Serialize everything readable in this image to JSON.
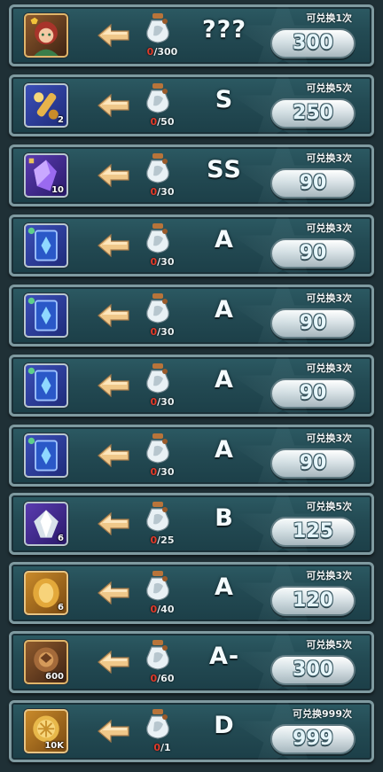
{
  "exchange_rows": [
    {
      "item_icon": "hero-portrait-icon",
      "item_style": "hero",
      "item_qty": "",
      "have": "0",
      "need": "/300",
      "grade": "???",
      "limit": "可兑换1次",
      "price": "300"
    },
    {
      "item_icon": "golden-scroll-icon",
      "item_style": "blue",
      "item_qty": "2",
      "have": "0",
      "need": "/50",
      "grade": "S",
      "limit": "可兑换5次",
      "price": "250"
    },
    {
      "item_icon": "purple-crystal-icon",
      "item_style": "purple",
      "item_qty": "10",
      "have": "0",
      "need": "/30",
      "grade": "SS",
      "limit": "可兑换3次",
      "price": "90"
    },
    {
      "item_icon": "blue-card-icon",
      "item_style": "blue",
      "item_qty": "",
      "have": "0",
      "need": "/30",
      "grade": "A",
      "limit": "可兑换3次",
      "price": "90"
    },
    {
      "item_icon": "blue-card-icon",
      "item_style": "blue",
      "item_qty": "",
      "have": "0",
      "need": "/30",
      "grade": "A",
      "limit": "可兑换3次",
      "price": "90"
    },
    {
      "item_icon": "blue-card-icon",
      "item_style": "blue",
      "item_qty": "",
      "have": "0",
      "need": "/30",
      "grade": "A",
      "limit": "可兑换3次",
      "price": "90"
    },
    {
      "item_icon": "blue-card-icon",
      "item_style": "blue",
      "item_qty": "",
      "have": "0",
      "need": "/30",
      "grade": "A",
      "limit": "可兑换3次",
      "price": "90"
    },
    {
      "item_icon": "silver-gem-icon",
      "item_style": "purple",
      "item_qty": "6",
      "have": "0",
      "need": "/25",
      "grade": "B",
      "limit": "可兑换5次",
      "price": "125"
    },
    {
      "item_icon": "gold-gem-icon",
      "item_style": "gold",
      "item_qty": "6",
      "have": "0",
      "need": "/40",
      "grade": "A",
      "limit": "可兑换3次",
      "price": "120"
    },
    {
      "item_icon": "bronze-medal-icon",
      "item_style": "hero",
      "item_qty": "600",
      "have": "0",
      "need": "/60",
      "grade": "A-",
      "limit": "可兑换5次",
      "price": "300"
    },
    {
      "item_icon": "gold-coin-icon",
      "item_style": "gold",
      "item_qty": "10K",
      "have": "0",
      "need": "/1",
      "grade": "D",
      "limit": "可兑换999次",
      "price": "999"
    }
  ],
  "colors": {
    "row_bg": "#234a53",
    "frame": "#7f9aa0",
    "have_red": "#e03a2a",
    "arrow": "#f0c88a"
  }
}
